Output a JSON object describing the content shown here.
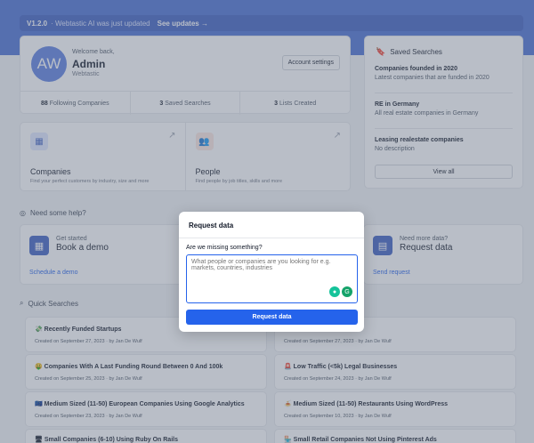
{
  "banner": {
    "version": "V1.2.0",
    "message": "· Webtastic AI was just updated",
    "link": "See updates →"
  },
  "user": {
    "initials": "AW",
    "greeting": "Welcome back,",
    "name": "Admin",
    "org": "Webtastic",
    "account_button": "Account settings"
  },
  "stats": [
    {
      "count": "88",
      "label": "Following Companies"
    },
    {
      "count": "3",
      "label": "Saved Searches"
    },
    {
      "count": "3",
      "label": "Lists Created"
    }
  ],
  "saved_searches": {
    "title": "Saved Searches",
    "items": [
      {
        "title": "Companies founded in 2020",
        "desc": "Latest companies that are funded in 2020"
      },
      {
        "title": "RE in Germany",
        "desc": "All real estate companies in Germany"
      },
      {
        "title": "Leasing realestate companies",
        "desc": "No description"
      }
    ],
    "view_all": "View all"
  },
  "categories": [
    {
      "name": "Companies",
      "desc": "Find your perfect customers by industry, size and more",
      "icon": "building-icon",
      "glyph": "▦"
    },
    {
      "name": "People",
      "desc": "Find people by job titles, skills and more",
      "icon": "people-icon",
      "glyph": "👥"
    }
  ],
  "help": {
    "title": "Need some help?",
    "cards": [
      {
        "small": "Get started",
        "big": "Book a demo",
        "link": "Schedule a demo"
      },
      {
        "small": "Need more data?",
        "big": "Request data",
        "link": "Send request"
      }
    ]
  },
  "quick_searches": {
    "title": "Quick Searches",
    "items": [
      {
        "title": "💸 Recently Funded Startups",
        "meta": "Created on September 27, 2023  ·  by Jan De Wulf"
      },
      {
        "title": "",
        "meta": "Created on September 27, 2023  ·  by Jan De Wulf"
      },
      {
        "title": "🤑 Companies With A Last Funding Round Between 0 And 100k",
        "meta": "Created on September 25, 2023  ·  by Jan De Wulf"
      },
      {
        "title": "🚨 Low Traffic (<5k) Legal Businesses",
        "meta": "Created on September 24, 2023  ·  by Jan De Wulf"
      },
      {
        "title": "🇪🇺 Medium Sized (11-50) European Companies Using Google Analytics",
        "meta": "Created on September 23, 2023  ·  by Jan De Wulf"
      },
      {
        "title": "🍝 Medium Sized (11-50) Restaurants Using WordPress",
        "meta": "Created on September 10, 2023  ·  by Jan De Wulf"
      },
      {
        "title": "🖥 Small Companies (6-10) Using Ruby On Rails",
        "meta": ""
      },
      {
        "title": "🏪 Small Retail Companies Not Using Pinterest Ads",
        "meta": ""
      }
    ]
  },
  "modal": {
    "title": "Request data",
    "question": "Are we missing something?",
    "placeholder": "What people or companies are you looking for e.g. markets, countries, industries",
    "submit": "Request data"
  },
  "colors": {
    "brand": "#4a6fd4",
    "primary": "#2563eb"
  }
}
